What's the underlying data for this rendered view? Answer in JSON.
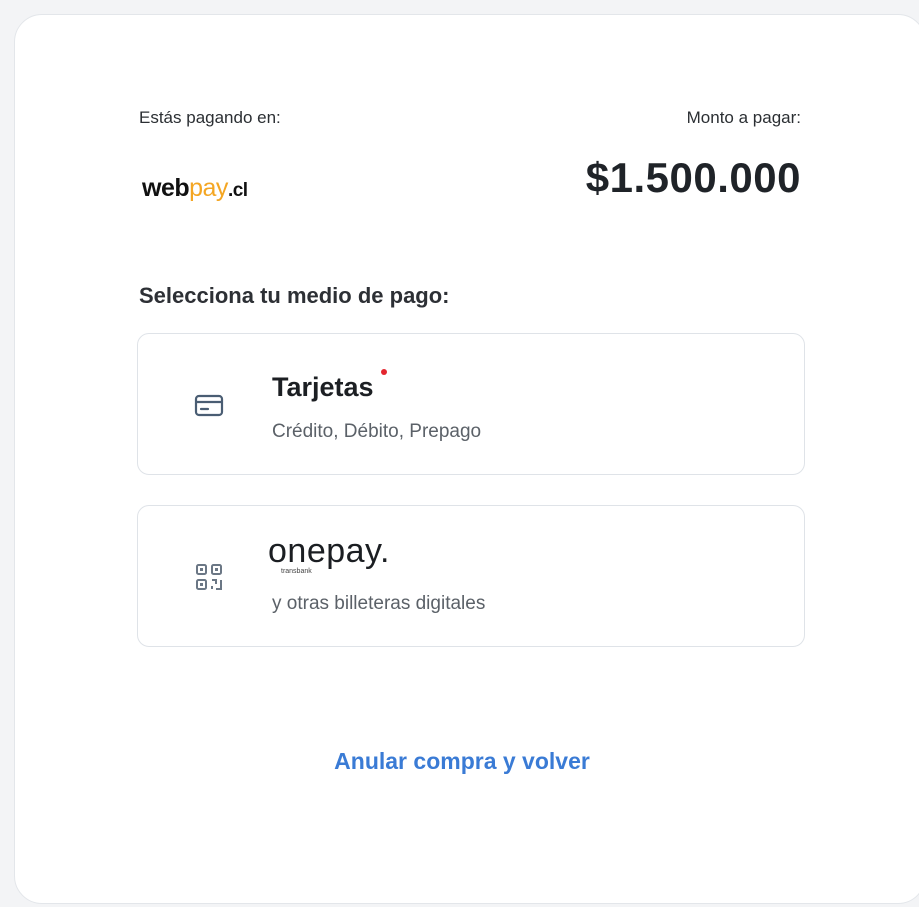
{
  "header": {
    "paying_label": "Estás pagando en:",
    "amount_label": "Monto a pagar:",
    "amount": "$1.500.000",
    "merchant_logo": {
      "part1": "web",
      "part2": "pay",
      "part3": ".cl"
    }
  },
  "payment": {
    "title": "Selecciona tu medio de pago:",
    "options": [
      {
        "icon": "credit-card-icon",
        "title": "Tarjetas",
        "subtitle": "Crédito, Débito, Prepago"
      },
      {
        "icon": "qr-code-icon",
        "logo": "onepay.",
        "logo_sub": "transbank",
        "subtitle": "y otras billeteras digitales"
      }
    ]
  },
  "actions": {
    "cancel": "Anular compra y volver"
  },
  "colors": {
    "accent": "#3a7bd5",
    "logo_orange": "#f4a623",
    "dot_red": "#e3262f"
  }
}
